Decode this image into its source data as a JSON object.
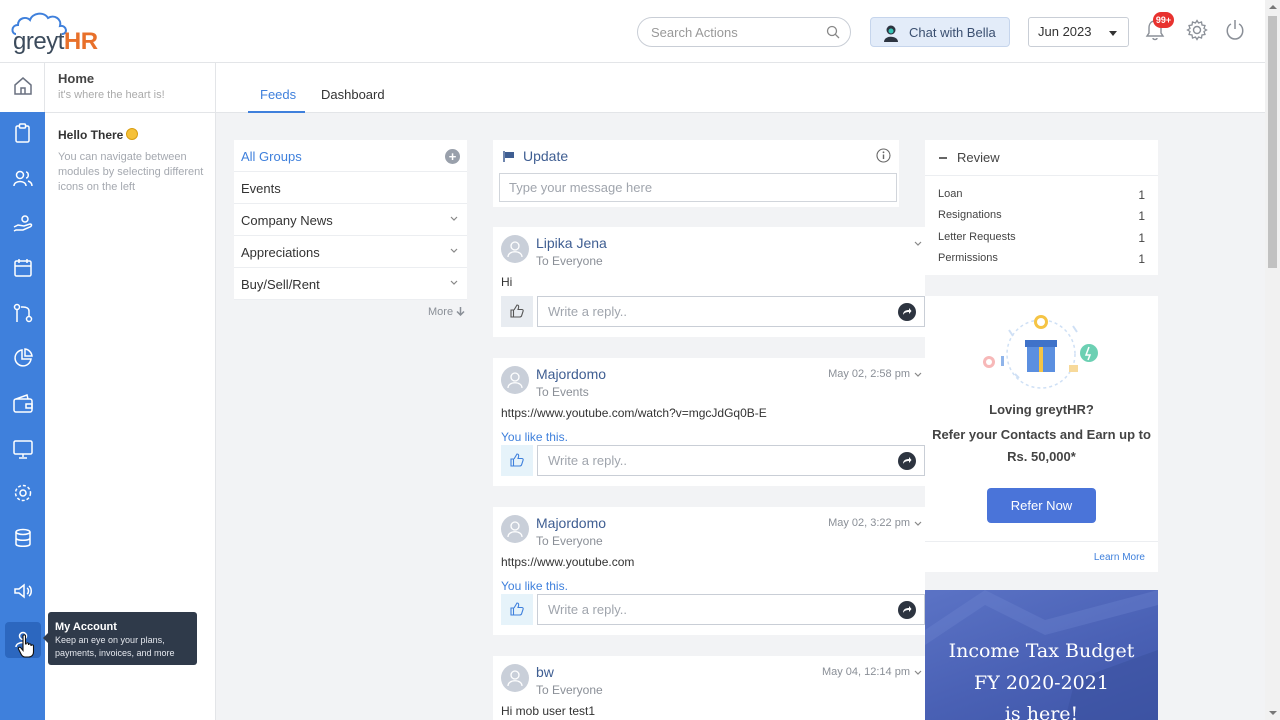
{
  "brand": {
    "name_part1": "greyt",
    "name_part2": "HR",
    "primary_color": "#3f80dc",
    "accent_color": "#e8702a"
  },
  "header": {
    "search_placeholder": "Search Actions",
    "chat_label": "Chat with Bella",
    "month": "Jun 2023",
    "notification_badge": "99+"
  },
  "module": {
    "title": "Home",
    "subtitle": "it's where the heart is!"
  },
  "sidebar_panel": {
    "greeting": "Hello There",
    "description": "You can navigate between modules by selecting different icons on the left"
  },
  "tabs": [
    {
      "label": "Feeds"
    },
    {
      "label": "Dashboard"
    }
  ],
  "groups": {
    "items": [
      {
        "label": "All Groups"
      },
      {
        "label": "Events"
      },
      {
        "label": "Company News"
      },
      {
        "label": "Appreciations"
      },
      {
        "label": "Buy/Sell/Rent"
      }
    ],
    "more_label": "More"
  },
  "update": {
    "title": "Update",
    "placeholder": "Type your message here"
  },
  "posts": [
    {
      "author": "Lipika Jena",
      "audience": "To Everyone",
      "time": "",
      "body": "Hi",
      "likes_text": "",
      "reply_placeholder": "Write a reply.."
    },
    {
      "author": "Majordomo",
      "audience": "To Events",
      "time": "May 02, 2:58 pm",
      "body": "https://www.youtube.com/watch?v=mgcJdGq0B-E",
      "likes_text": "You  like this.",
      "reply_placeholder": "Write a reply.."
    },
    {
      "author": "Majordomo",
      "audience": "To Everyone",
      "time": "May 02, 3:22 pm",
      "body": "https://www.youtube.com",
      "likes_text": "You  like this.",
      "reply_placeholder": "Write a reply.."
    },
    {
      "author": "bw",
      "audience": "To Everyone",
      "time": "May 04, 12:14 pm",
      "body": "Hi mob user test1",
      "likes_text": "",
      "reply_placeholder": ""
    }
  ],
  "review": {
    "title": "Review",
    "rows": [
      {
        "label": "Loan",
        "value": "1"
      },
      {
        "label": "Resignations",
        "value": "1"
      },
      {
        "label": "Letter Requests",
        "value": "1"
      },
      {
        "label": "Permissions",
        "value": "1"
      }
    ]
  },
  "refer": {
    "question": "Loving greytHR?",
    "offer_line1": "Refer your Contacts and Earn up to",
    "offer_line2": "Rs. 50,000*",
    "button": "Refer Now",
    "learn_more": "Learn More"
  },
  "banner": {
    "line1": "Income Tax Budget",
    "line2": "FY 2020-2021",
    "line3": "is here!"
  },
  "tooltip": {
    "title": "My Account",
    "description": "Keep an eye on your plans, payments, invoices, and more"
  },
  "rail_icons": [
    "home-icon",
    "clipboard-icon",
    "people-icon",
    "hand-coins-icon",
    "calendar-icon",
    "workflow-icon",
    "pie-chart-icon",
    "wallet-icon",
    "monitor-icon",
    "settings-cog-icon",
    "database-icon",
    "megaphone-icon",
    "account-icon"
  ]
}
